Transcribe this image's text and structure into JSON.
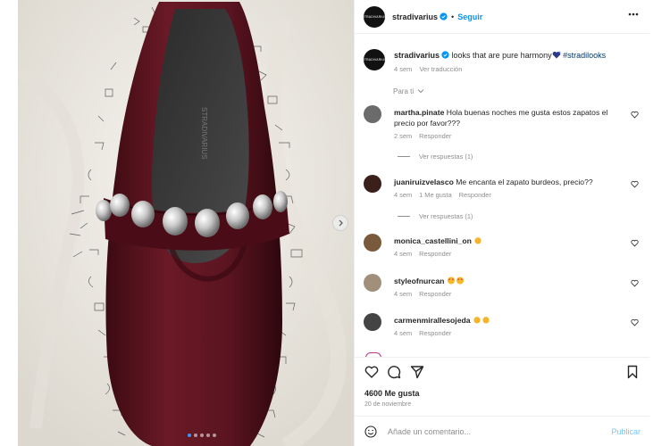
{
  "post": {
    "username": "stradivarius",
    "avatar_text": "STRADIVARIUS",
    "separator": "•",
    "follow_label": "Seguir",
    "more_icon": "more-horizontal-icon"
  },
  "caption": {
    "username": "stradivarius",
    "text": "looks that are pure harmony",
    "hashtag": "#stradilooks",
    "time": "4 sem",
    "translate": "Ver traducción"
  },
  "filter_label": "Para ti",
  "comments": [
    {
      "user": "martha.pinate",
      "text": "Hola buenas noches me gusta estos zapatos el precio por favor???",
      "time": "2 sem",
      "likes": "",
      "reply": "Responder",
      "replies": "Ver respuestas (1)",
      "avatar_color": "#6b6b6b"
    },
    {
      "user": "juaniruizvelasco",
      "text": "Me encanta el zapato burdeos, precio??",
      "time": "4 sem",
      "likes": "1 Me gusta",
      "reply": "Responder",
      "replies": "Ver respuestas (1)",
      "avatar_color": "#3b1f1a"
    },
    {
      "user": "monica_castellini_on",
      "text": "",
      "time": "4 sem",
      "likes": "",
      "reply": "Responder",
      "replies": "",
      "avatar_color": "#7a5a3c"
    },
    {
      "user": "styleofnurcan",
      "text": "",
      "time": "4 sem",
      "likes": "",
      "reply": "Responder",
      "replies": "",
      "avatar_color": "#a08f7a"
    },
    {
      "user": "carmenmirallesojeda",
      "text": "",
      "time": "4 sem",
      "likes": "",
      "reply": "Responder",
      "replies": "",
      "avatar_color": "#444444"
    }
  ],
  "likes_count": "4600 Me gusta",
  "date": "20 de noviembre",
  "add_comment_placeholder": "Añade un comentario...",
  "publish_label": "Publicar",
  "carousel": {
    "total": 5,
    "active_index": 0
  },
  "colors": {
    "accent": "#0095f6",
    "verified": "#0095f6",
    "shoe": "#5e1420",
    "link": "#00376b"
  }
}
